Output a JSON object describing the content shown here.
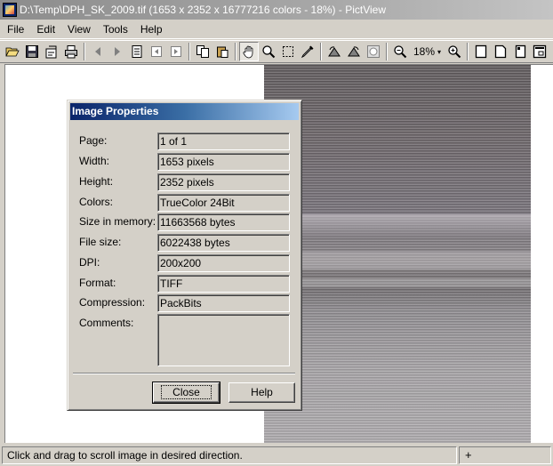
{
  "window": {
    "title": "D:\\Temp\\DPH_SK_2009.tif (1653 x 2352 x 16777216 colors - 18%) - PictView"
  },
  "menu": {
    "items": [
      "File",
      "Edit",
      "View",
      "Tools",
      "Help"
    ]
  },
  "toolbar": {
    "zoom_label": "18%",
    "zoom_arrow": "▾",
    "icons": [
      "open-icon",
      "save-icon",
      "properties-icon",
      "print-icon",
      "back-icon",
      "forward-icon",
      "page-icon",
      "prev-page-icon",
      "next-page-icon",
      "copy-icon",
      "paste-icon",
      "hand-icon",
      "zoom-icon",
      "select-icon",
      "eyedropper-icon",
      "rotate-left-icon",
      "rotate-right-icon",
      "adjust-icon",
      "zoom-out-icon",
      "zoom-in-icon",
      "fit-page-icon",
      "fit-width-icon",
      "actual-size-icon",
      "fullscreen-icon"
    ],
    "active_tool": "hand-icon"
  },
  "dialog": {
    "title": "Image Properties",
    "rows": [
      {
        "label": "Page:",
        "value": "1 of 1"
      },
      {
        "label": "Width:",
        "value": "1653 pixels"
      },
      {
        "label": "Height:",
        "value": "2352 pixels"
      },
      {
        "label": "Colors:",
        "value": "TrueColor 24Bit"
      },
      {
        "label": "Size in memory:",
        "value": "11663568 bytes"
      },
      {
        "label": "File size:",
        "value": "6022438 bytes"
      },
      {
        "label": "DPI:",
        "value": "200x200"
      },
      {
        "label": "Format:",
        "value": "TIFF"
      },
      {
        "label": "Compression:",
        "value": "PackBits"
      },
      {
        "label": "Comments:",
        "value": ""
      }
    ],
    "close_label": "Close",
    "help_label": "Help"
  },
  "statusbar": {
    "text": "Click and drag to scroll image in desired direction.",
    "extra": "+"
  },
  "colors": {
    "dialog_title_start": "#0a246a",
    "dialog_title_end": "#a6caf0",
    "chrome": "#d4d0c8"
  }
}
